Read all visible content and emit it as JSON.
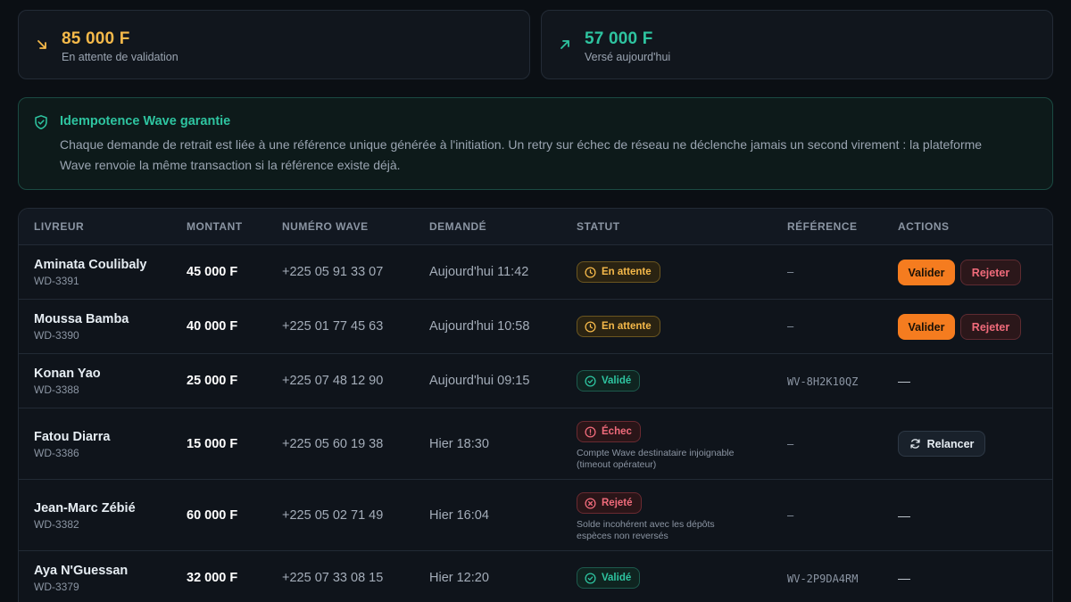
{
  "stats": [
    {
      "value": "85 000 F",
      "label": "En attente de validation",
      "trend": "down",
      "color": "#f5b94a",
      "icon": "arrow-down-right-icon"
    },
    {
      "value": "57 000 F",
      "label": "Versé aujourd'hui",
      "trend": "up",
      "color": "#2ec4a0",
      "icon": "arrow-up-right-icon"
    }
  ],
  "info": {
    "icon": "shield-check-icon",
    "title": "Idempotence Wave garantie",
    "text": "Chaque demande de retrait est liée à une référence unique générée à l'initiation. Un retry sur échec de réseau ne déclenche jamais un second virement : la plateforme Wave renvoie la même transaction si la référence existe déjà."
  },
  "table": {
    "headers": {
      "livreur": "LIVREUR",
      "montant": "MONTANT",
      "numero": "NUMÉRO WAVE",
      "demande": "DEMANDÉ",
      "statut": "STATUT",
      "reference": "RÉFÉRENCE",
      "actions": "ACTIONS"
    },
    "rows": [
      {
        "name": "Aminata Coulibaly",
        "id": "WD-3391",
        "amount": "45 000 F",
        "phone": "+225 05 91 33 07",
        "date": "Aujourd'hui 11:42",
        "status": "En attente",
        "status_kind": "pending",
        "note": "",
        "ref": "–",
        "actions": {
          "validate": "Valider",
          "reject": "Rejeter"
        }
      },
      {
        "name": "Moussa Bamba",
        "id": "WD-3390",
        "amount": "40 000 F",
        "phone": "+225 01 77 45 63",
        "date": "Aujourd'hui 10:58",
        "status": "En attente",
        "status_kind": "pending",
        "note": "",
        "ref": "–",
        "actions": {
          "validate": "Valider",
          "reject": "Rejeter"
        }
      },
      {
        "name": "Konan Yao",
        "id": "WD-3388",
        "amount": "25 000 F",
        "phone": "+225 07 48 12 90",
        "date": "Aujourd'hui 09:15",
        "status": "Validé",
        "status_kind": "ok",
        "note": "",
        "ref": "WV-8H2K10QZ",
        "actions": {
          "none": "—"
        }
      },
      {
        "name": "Fatou Diarra",
        "id": "WD-3386",
        "amount": "15 000 F",
        "phone": "+225 05 60 19 38",
        "date": "Hier 18:30",
        "status": "Échec",
        "status_kind": "fail",
        "note": "Compte Wave destinataire injoignable (timeout opérateur)",
        "ref": "–",
        "actions": {
          "retry": "Relancer"
        }
      },
      {
        "name": "Jean-Marc Zébié",
        "id": "WD-3382",
        "amount": "60 000 F",
        "phone": "+225 05 02 71 49",
        "date": "Hier 16:04",
        "status": "Rejeté",
        "status_kind": "rejected",
        "note": "Solde incohérent avec les dépôts espèces non reversés",
        "ref": "–",
        "actions": {
          "none": "—"
        }
      },
      {
        "name": "Aya N'Guessan",
        "id": "WD-3379",
        "amount": "32 000 F",
        "phone": "+225 07 33 08 15",
        "date": "Hier 12:20",
        "status": "Validé",
        "status_kind": "ok",
        "note": "",
        "ref": "WV-2P9DA4RM",
        "actions": {
          "none": "—"
        }
      }
    ]
  }
}
